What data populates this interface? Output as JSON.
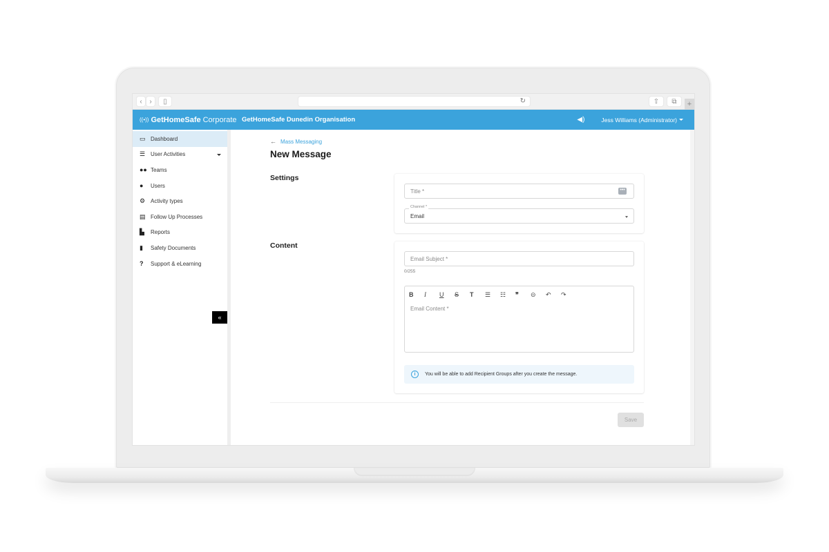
{
  "browser": {
    "back_icon": "‹",
    "forward_icon": "›",
    "sidebar_icon": "▯",
    "reload_icon": "↻",
    "share_icon": "⇧",
    "tabs_icon": "⧉",
    "newtab_icon": "+"
  },
  "header": {
    "logo_icon": "📶",
    "logo_brand": "GetHomeSafe",
    "logo_suffix": "Corporate",
    "organisation": "GetHomeSafe Dunedin Organisation",
    "speaker_icon": "🔊",
    "user": "Jess Williams (Administrator)"
  },
  "sidebar": {
    "items": [
      {
        "label": "Dashboard",
        "icon": "💻",
        "active": true
      },
      {
        "label": "User Activities",
        "icon": "☰",
        "has_submenu": true
      },
      {
        "label": "Teams",
        "icon": "👥"
      },
      {
        "label": "Users",
        "icon": "👤"
      },
      {
        "label": "Activity types",
        "icon": "⚙"
      },
      {
        "label": "Follow Up Processes",
        "icon": "📋"
      },
      {
        "label": "Reports",
        "icon": "📊"
      },
      {
        "label": "Safety Documents",
        "icon": "📄"
      },
      {
        "label": "Support & eLearning",
        "icon": "?"
      }
    ],
    "collapse_label": "«"
  },
  "main": {
    "back_arrow": "←",
    "back_link": "Mass Messaging",
    "title": "New Message",
    "settings": {
      "label": "Settings",
      "title_placeholder": "Title *",
      "title_badge": "•••",
      "channel_label": "Channel *",
      "channel_value": "Email"
    },
    "content": {
      "label": "Content",
      "subject_placeholder": "Email Subject *",
      "subject_counter": "0/255",
      "toolbar": [
        "B",
        "I",
        "U",
        "S",
        "T",
        "☰",
        "☷",
        "❞",
        "⊝",
        "↶",
        "↷"
      ],
      "content_placeholder": "Email Content *",
      "info_icon": "i",
      "info_text": "You will be able to add Recipient Groups after you create the message."
    },
    "save_label": "Save"
  }
}
